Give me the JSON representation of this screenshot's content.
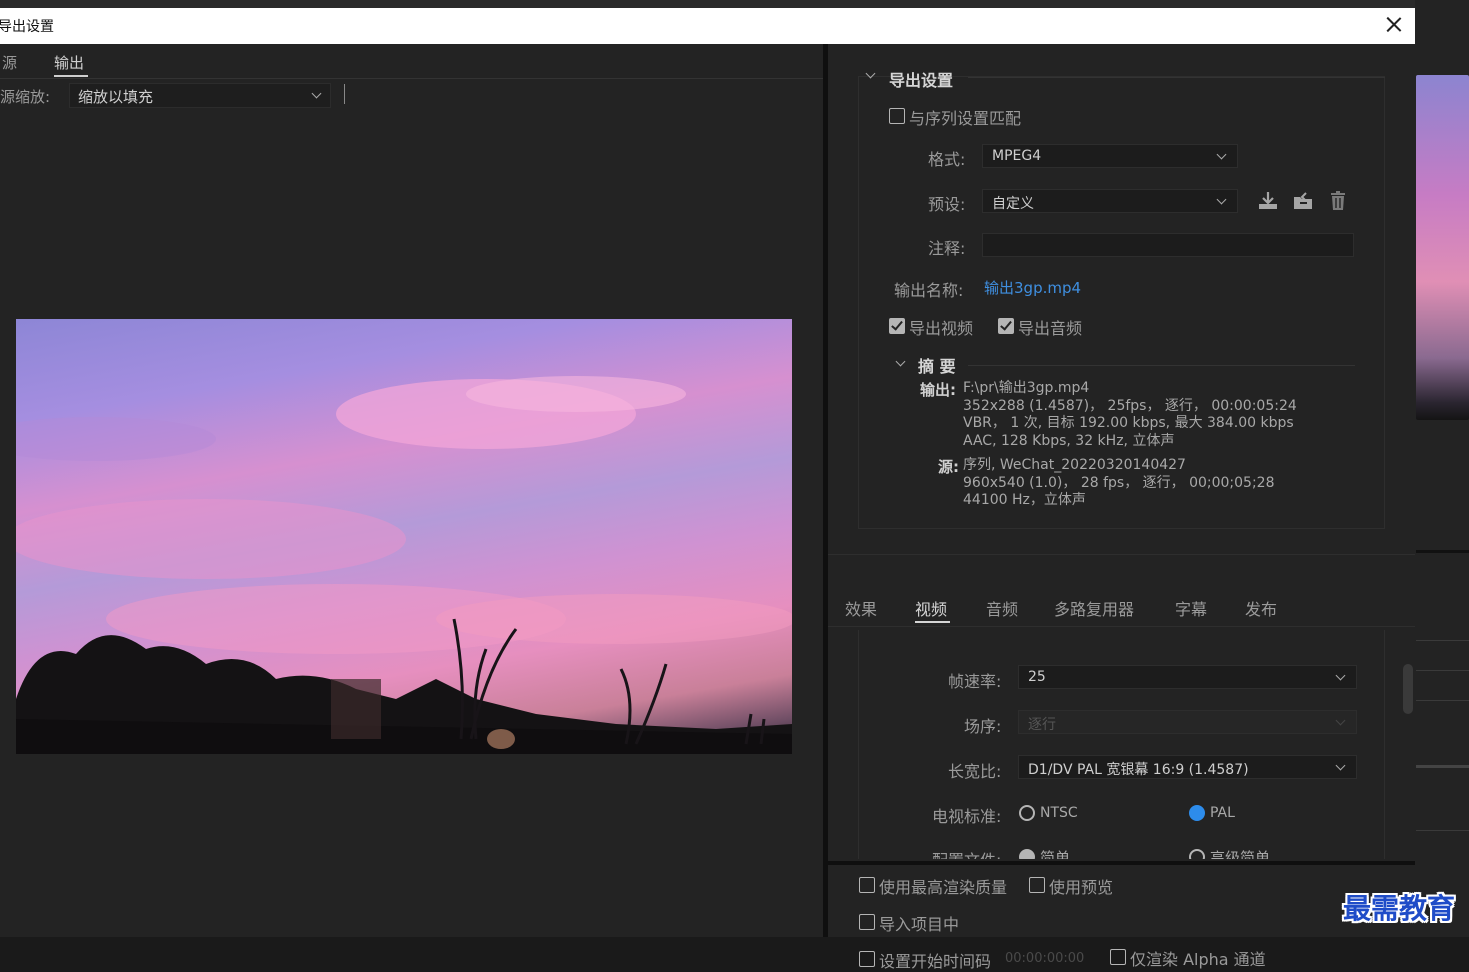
{
  "dialog": {
    "title": "导出设置"
  },
  "left": {
    "tabs": [
      {
        "label": "源"
      },
      {
        "label": "输出"
      }
    ],
    "scale_label": "源缩放:",
    "scale_value": "缩放以填充"
  },
  "export": {
    "section_title": "导出设置",
    "match_sequence_label": "与序列设置匹配",
    "format_label": "格式:",
    "format_value": "MPEG4",
    "preset_label": "预设:",
    "preset_value": "自定义",
    "comment_label": "注释:",
    "comment_value": "",
    "output_name_label": "输出名称:",
    "output_name_value": "输出3gp.mp4",
    "export_video_label": "导出视频",
    "export_audio_label": "导出音频"
  },
  "summary": {
    "title": "摘 要",
    "output_key": "输出:",
    "output_lines": [
      "F:\\pr\\输出3gp.mp4",
      "352x288 (1.4587)， 25fps， 逐行， 00:00:05:24",
      "VBR， 1 次, 目标 192.00 kbps, 最大 384.00 kbps",
      "AAC, 128 Kbps, 32  kHz, 立体声"
    ],
    "source_key": "源:",
    "source_lines": [
      "序列, WeChat_20220320140427",
      "960x540 (1.0)， 28 fps， 逐行， 00;00;05;28",
      "44100 Hz，立体声"
    ]
  },
  "tabs": [
    {
      "label": "效果"
    },
    {
      "label": "视频"
    },
    {
      "label": "音频"
    },
    {
      "label": "多路复用器"
    },
    {
      "label": "字幕"
    },
    {
      "label": "发布"
    }
  ],
  "video": {
    "fps_label": "帧速率:",
    "fps_value": "25",
    "field_label": "场序:",
    "field_value": "逐行",
    "aspect_label": "长宽比:",
    "aspect_value": "D1/DV PAL 宽银幕 16:9 (1.4587)",
    "tv_label": "电视标准:",
    "ntsc_label": "NTSC",
    "pal_label": "PAL",
    "profile_label": "配置文件:",
    "profile_simple": "简单",
    "profile_adv": "高级简单"
  },
  "bottom": {
    "max_quality_label": "使用最高渲染质量",
    "use_preview_label": "使用预览",
    "import_label": "导入项目中",
    "start_tc_label": "设置开始时间码",
    "start_tc_value": "00:00:00:00",
    "alpha_label": "仅渲染 Alpha 通道"
  },
  "watermark": "最需教育",
  "colors": {
    "accent": "#2d8ceb",
    "link": "#3f8fe0",
    "bg": "#232323"
  }
}
